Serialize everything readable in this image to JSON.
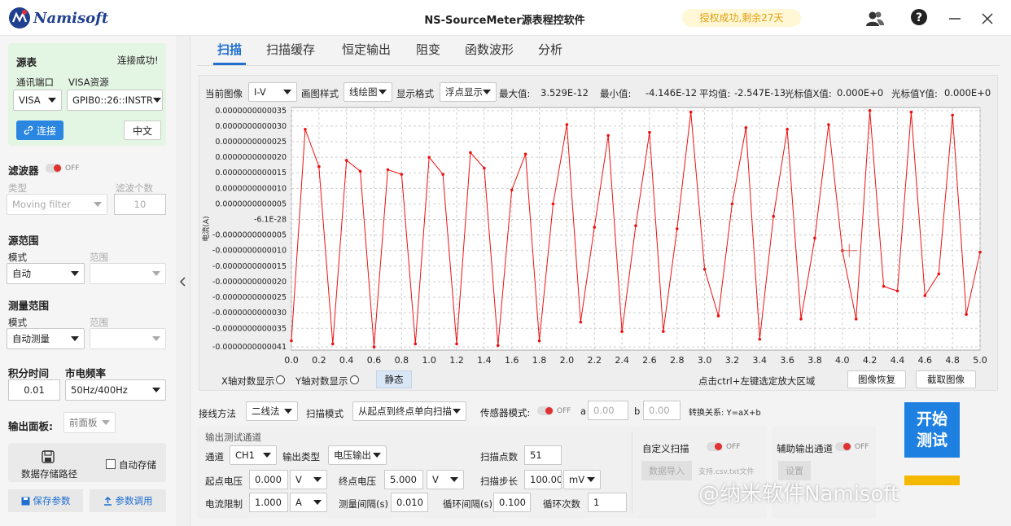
{
  "app": {
    "logo_text": "Namisoft",
    "title": "NS-SourceMeter源表程控软件",
    "license": "授权成功,剩余27天",
    "icons": [
      "user-icon",
      "help-icon",
      "minimize-icon",
      "close-icon"
    ]
  },
  "left": {
    "source": {
      "title": "源表",
      "status": "连接成功!",
      "port_label": "通讯端口",
      "port_value": "VISA",
      "visa_label": "VISA资源",
      "visa_value": "GPIB0::26::INSTR",
      "connect": "连接",
      "lang": "中文"
    },
    "filter": {
      "title": "滤波器",
      "toggle": "OFF",
      "type_label": "类型",
      "type_value": "Moving filter",
      "count_label": "滤波个数",
      "count_value": "10"
    },
    "src_range": {
      "title": "源范围",
      "mode_label": "模式",
      "mode_value": "自动",
      "range_label": "范围"
    },
    "meas_range": {
      "title": "测量范围",
      "mode_label": "模式",
      "mode_value": "自动测量",
      "range_label": "范围"
    },
    "integration": {
      "title": "积分时间",
      "value": "0.01"
    },
    "freq": {
      "title": "市电频率",
      "value": "50Hz/400Hz"
    },
    "output": {
      "title": "输出面板:",
      "value": "前面板"
    },
    "storage": {
      "path": "数据存储路径",
      "auto": "自动存储"
    },
    "save": "保存参数",
    "load": "参数调用"
  },
  "tabs": [
    "扫描",
    "扫描缓存",
    "恒定输出",
    "阻变",
    "函数波形",
    "分析"
  ],
  "toolbar": {
    "image_label": "当前图像",
    "image_value": "I-V",
    "style_label": "画图样式",
    "style_value": "线绘图",
    "format_label": "显示格式",
    "format_value": "浮点显示",
    "max_label": "最大值:",
    "max_value": "3.529E-12",
    "min_label": "最小值:",
    "min_value": "-4.146E-12",
    "avg_label": "平均值:",
    "avg_value": "-2.547E-13",
    "cx_label": "光标值X值:",
    "cx_value": "0.000E+0",
    "cy_label": "光标值Y值:",
    "cy_value": "0.000E+0"
  },
  "chart_bottom": {
    "xlog": "X轴对数显示",
    "ylog": "Y轴对数显示",
    "static": "静态",
    "hint": "点击ctrl+左键选定放大区域",
    "restore": "图像恢复",
    "capture": "截取图像"
  },
  "chart_data": {
    "type": "line",
    "xlabel": "电压(V)",
    "ylabel": "电流(A)",
    "xlim": [
      0,
      5
    ],
    "ylim": [
      -4.2e-12,
      3.6e-12
    ],
    "x_ticks": [
      "0.0",
      "0.2",
      "0.4",
      "0.6",
      "0.8",
      "1.0",
      "1.2",
      "1.4",
      "1.6",
      "1.8",
      "2.0",
      "2.2",
      "2.4",
      "2.6",
      "2.8",
      "3.0",
      "3.2",
      "3.4",
      "3.6",
      "3.8",
      "4.0",
      "4.2",
      "4.4",
      "4.6",
      "4.8",
      "5.0"
    ],
    "y_ticks": [
      {
        "v": 3.5e-12,
        "t": "0.0000000000035"
      },
      {
        "v": 3e-12,
        "t": "0.0000000000030"
      },
      {
        "v": 2.5e-12,
        "t": "0.0000000000025"
      },
      {
        "v": 2e-12,
        "t": "0.0000000000020"
      },
      {
        "v": 1.5e-12,
        "t": "0.0000000000015"
      },
      {
        "v": 1e-12,
        "t": "0.0000000000010"
      },
      {
        "v": 5e-13,
        "t": "0.0000000000005"
      },
      {
        "v": 0.0,
        "t": "-6.1E-28"
      },
      {
        "v": -5e-13,
        "t": "-0.0000000000005"
      },
      {
        "v": -1e-12,
        "t": "-0.0000000000010"
      },
      {
        "v": -1.5e-12,
        "t": "-0.0000000000015"
      },
      {
        "v": -2e-12,
        "t": "-0.0000000000020"
      },
      {
        "v": -2.5e-12,
        "t": "-0.0000000000025"
      },
      {
        "v": -3e-12,
        "t": "-0.0000000000030"
      },
      {
        "v": -3.5e-12,
        "t": "-0.0000000000035"
      },
      {
        "v": -4.1e-12,
        "t": "-0.0000000000041"
      }
    ],
    "grid": true,
    "color": "#ee1111",
    "x": [
      0.0,
      0.1,
      0.2,
      0.3,
      0.4,
      0.5,
      0.6,
      0.7,
      0.8,
      0.9,
      1.0,
      1.1,
      1.2,
      1.3,
      1.4,
      1.5,
      1.6,
      1.7,
      1.8,
      1.9,
      2.0,
      2.1,
      2.2,
      2.3,
      2.4,
      2.5,
      2.6,
      2.7,
      2.8,
      2.9,
      3.0,
      3.1,
      3.2,
      3.3,
      3.4,
      3.5,
      3.6,
      3.7,
      3.8,
      3.9,
      4.0,
      4.1,
      4.2,
      4.3,
      4.4,
      4.5,
      4.6,
      4.7,
      4.8,
      4.9,
      5.0
    ],
    "y": [
      -3.9e-12,
      2.9e-12,
      1.7e-12,
      -4e-12,
      1.9e-12,
      1.55e-12,
      -4.1e-12,
      1.6e-12,
      1.45e-12,
      -4e-12,
      2e-12,
      1.45e-12,
      -4e-12,
      2.15e-12,
      1.65e-12,
      -4.05e-12,
      9.5e-13,
      2.1e-12,
      -3.9e-12,
      5e-13,
      3.05e-12,
      -3.3e-12,
      -2.5e-13,
      2.7e-12,
      -3.6e-12,
      -2e-13,
      2.8e-12,
      -3.6e-12,
      -3e-13,
      3.45e-12,
      -1.6e-12,
      -3.1e-12,
      5e-13,
      2.95e-12,
      -3.85e-12,
      1e-13,
      2.9e-12,
      -3.2e-12,
      -6e-13,
      3.05e-12,
      -1e-12,
      -3.2e-12,
      3.5e-12,
      -2.15e-12,
      -2.3e-12,
      3.45e-12,
      -2.45e-12,
      -1.75e-12,
      3.35e-12,
      -3.05e-12,
      -1.05e-12,
      3.3e-12
    ]
  },
  "controls": {
    "wiring_label": "接线方法",
    "wiring_value": "二线法",
    "scan_mode_label": "扫描模式",
    "scan_mode_value": "从起点到终点单向扫描",
    "sensor_label": "传感器模式:",
    "sensor_toggle": "OFF",
    "a_label": "a",
    "a_value": "0.00",
    "b_label": "b",
    "b_value": "0.00",
    "relation": "转换关系: Y=aX+b",
    "section": "输出测试通道",
    "channel_label": "通道",
    "channel_value": "CH1",
    "out_type_label": "输出类型",
    "out_type_value": "电压输出",
    "points_label": "扫描点数",
    "points_value": "51",
    "start_label": "起点电压",
    "start_value": "0.000",
    "start_unit": "V",
    "end_label": "终点电压",
    "end_value": "5.000",
    "end_unit": "V",
    "step_label": "扫描步长",
    "step_value": "100.00",
    "step_unit": "mV",
    "limit_label": "电流限制",
    "limit_value": "1.000",
    "limit_unit": "A",
    "interval_label": "测量间隔(s)",
    "interval_value": "0.010",
    "loop_interval_label": "循环间隔(s)",
    "loop_interval_value": "0.100",
    "loop_count_label": "循环次数",
    "loop_count_value": "1",
    "custom_label": "自定义扫描",
    "custom_toggle": "OFF",
    "import_btn": "数据导入",
    "import_hint": "支持.csv.txt文件",
    "aux_label": "辅助输出通道",
    "aux_toggle": "OFF",
    "aux_btn": "设置",
    "start_btn": "开始测试"
  },
  "watermark": "@纳米软件Namisoft"
}
